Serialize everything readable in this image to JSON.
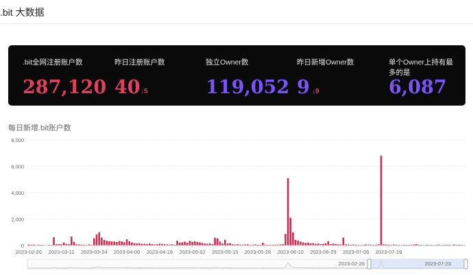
{
  "header": {
    "title": ".bit 大数据"
  },
  "stats": [
    {
      "label": ".bit全网注册账户数",
      "value": "287,120",
      "delta": "",
      "color": "#e0405e"
    },
    {
      "label": "昨日注册账户数",
      "value": "40",
      "delta": "↓5",
      "color": "#e0405e"
    },
    {
      "label": "独立Owner数",
      "value": "119,052",
      "delta": "",
      "color": "#7a54ff"
    },
    {
      "label": "昨日新增Owner数",
      "value": "9",
      "delta": "↓9",
      "color": "#7a54ff"
    },
    {
      "label": "单个Owner上持有最多的是",
      "value": "6,087",
      "delta": "",
      "color": "#7a54ff"
    }
  ],
  "chart_section": {
    "title": "每日新增.bit账户数"
  },
  "chart_data": {
    "type": "bar",
    "title": "",
    "xlabel": "",
    "ylabel": "",
    "ylim": [
      0,
      8000
    ],
    "yticks": [
      "0",
      "2,000",
      "4,000",
      "6,000",
      "8,000"
    ],
    "xtick_labels": [
      "2023-02-26",
      "2023-03-11",
      "2023-03-24",
      "2023-04-06",
      "2023-04-19",
      "2023-05-02",
      "2023-05-15",
      "2023-05-28",
      "2023-06-10",
      "2023-06-23",
      "2023-07-06",
      "2023-07-19"
    ],
    "start_date": "2023-02-26",
    "color": "#d0284f",
    "values": [
      80,
      60,
      70,
      40,
      60,
      50,
      40,
      30,
      50,
      40,
      620,
      100,
      110,
      90,
      230,
      120,
      100,
      680,
      280,
      90,
      80,
      70,
      60,
      40,
      90,
      50,
      550,
      830,
      1000,
      600,
      420,
      360,
      330,
      310,
      300,
      270,
      340,
      310,
      250,
      470,
      320,
      230,
      180,
      160,
      170,
      120,
      130,
      110,
      150,
      110,
      80,
      100,
      140,
      120,
      100,
      80,
      70,
      90,
      60,
      360,
      220,
      240,
      290,
      210,
      350,
      280,
      320,
      270,
      240,
      190,
      150,
      130,
      150,
      100,
      590,
      540,
      300,
      160,
      430,
      150,
      180,
      90,
      80,
      100,
      70,
      70,
      80,
      90,
      50,
      60,
      80,
      60,
      50,
      200,
      70,
      50,
      60,
      50,
      70,
      60,
      80,
      110,
      880,
      5100,
      2100,
      1000,
      420,
      380,
      300,
      240,
      200,
      220,
      160,
      180,
      130,
      150,
      100,
      130,
      160,
      330,
      110,
      150,
      120,
      90,
      80,
      600,
      90,
      80,
      60,
      70,
      60,
      50,
      40,
      50,
      80,
      70,
      60,
      50,
      60,
      90,
      6800,
      90,
      70,
      60,
      50,
      70,
      60,
      50,
      40,
      60,
      50,
      50,
      60,
      70,
      100,
      60,
      50,
      40,
      60,
      50,
      50,
      40,
      60,
      70,
      40,
      50,
      60,
      50,
      40,
      80,
      50,
      60,
      50,
      40
    ]
  },
  "zoom_slider": {
    "start_label": "2023-02-26",
    "end_label": "2023-07-23"
  }
}
